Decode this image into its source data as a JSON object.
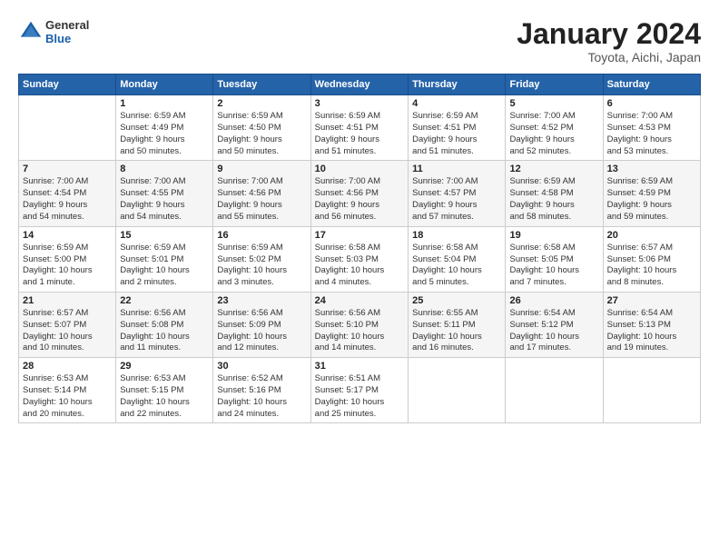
{
  "logo": {
    "general": "General",
    "blue": "Blue"
  },
  "title": "January 2024",
  "subtitle": "Toyota, Aichi, Japan",
  "days_header": [
    "Sunday",
    "Monday",
    "Tuesday",
    "Wednesday",
    "Thursday",
    "Friday",
    "Saturday"
  ],
  "weeks": [
    [
      {
        "num": "",
        "info": ""
      },
      {
        "num": "1",
        "info": "Sunrise: 6:59 AM\nSunset: 4:49 PM\nDaylight: 9 hours\nand 50 minutes."
      },
      {
        "num": "2",
        "info": "Sunrise: 6:59 AM\nSunset: 4:50 PM\nDaylight: 9 hours\nand 50 minutes."
      },
      {
        "num": "3",
        "info": "Sunrise: 6:59 AM\nSunset: 4:51 PM\nDaylight: 9 hours\nand 51 minutes."
      },
      {
        "num": "4",
        "info": "Sunrise: 6:59 AM\nSunset: 4:51 PM\nDaylight: 9 hours\nand 51 minutes."
      },
      {
        "num": "5",
        "info": "Sunrise: 7:00 AM\nSunset: 4:52 PM\nDaylight: 9 hours\nand 52 minutes."
      },
      {
        "num": "6",
        "info": "Sunrise: 7:00 AM\nSunset: 4:53 PM\nDaylight: 9 hours\nand 53 minutes."
      }
    ],
    [
      {
        "num": "7",
        "info": "Sunrise: 7:00 AM\nSunset: 4:54 PM\nDaylight: 9 hours\nand 54 minutes."
      },
      {
        "num": "8",
        "info": "Sunrise: 7:00 AM\nSunset: 4:55 PM\nDaylight: 9 hours\nand 54 minutes."
      },
      {
        "num": "9",
        "info": "Sunrise: 7:00 AM\nSunset: 4:56 PM\nDaylight: 9 hours\nand 55 minutes."
      },
      {
        "num": "10",
        "info": "Sunrise: 7:00 AM\nSunset: 4:56 PM\nDaylight: 9 hours\nand 56 minutes."
      },
      {
        "num": "11",
        "info": "Sunrise: 7:00 AM\nSunset: 4:57 PM\nDaylight: 9 hours\nand 57 minutes."
      },
      {
        "num": "12",
        "info": "Sunrise: 6:59 AM\nSunset: 4:58 PM\nDaylight: 9 hours\nand 58 minutes."
      },
      {
        "num": "13",
        "info": "Sunrise: 6:59 AM\nSunset: 4:59 PM\nDaylight: 9 hours\nand 59 minutes."
      }
    ],
    [
      {
        "num": "14",
        "info": "Sunrise: 6:59 AM\nSunset: 5:00 PM\nDaylight: 10 hours\nand 1 minute."
      },
      {
        "num": "15",
        "info": "Sunrise: 6:59 AM\nSunset: 5:01 PM\nDaylight: 10 hours\nand 2 minutes."
      },
      {
        "num": "16",
        "info": "Sunrise: 6:59 AM\nSunset: 5:02 PM\nDaylight: 10 hours\nand 3 minutes."
      },
      {
        "num": "17",
        "info": "Sunrise: 6:58 AM\nSunset: 5:03 PM\nDaylight: 10 hours\nand 4 minutes."
      },
      {
        "num": "18",
        "info": "Sunrise: 6:58 AM\nSunset: 5:04 PM\nDaylight: 10 hours\nand 5 minutes."
      },
      {
        "num": "19",
        "info": "Sunrise: 6:58 AM\nSunset: 5:05 PM\nDaylight: 10 hours\nand 7 minutes."
      },
      {
        "num": "20",
        "info": "Sunrise: 6:57 AM\nSunset: 5:06 PM\nDaylight: 10 hours\nand 8 minutes."
      }
    ],
    [
      {
        "num": "21",
        "info": "Sunrise: 6:57 AM\nSunset: 5:07 PM\nDaylight: 10 hours\nand 10 minutes."
      },
      {
        "num": "22",
        "info": "Sunrise: 6:56 AM\nSunset: 5:08 PM\nDaylight: 10 hours\nand 11 minutes."
      },
      {
        "num": "23",
        "info": "Sunrise: 6:56 AM\nSunset: 5:09 PM\nDaylight: 10 hours\nand 12 minutes."
      },
      {
        "num": "24",
        "info": "Sunrise: 6:56 AM\nSunset: 5:10 PM\nDaylight: 10 hours\nand 14 minutes."
      },
      {
        "num": "25",
        "info": "Sunrise: 6:55 AM\nSunset: 5:11 PM\nDaylight: 10 hours\nand 16 minutes."
      },
      {
        "num": "26",
        "info": "Sunrise: 6:54 AM\nSunset: 5:12 PM\nDaylight: 10 hours\nand 17 minutes."
      },
      {
        "num": "27",
        "info": "Sunrise: 6:54 AM\nSunset: 5:13 PM\nDaylight: 10 hours\nand 19 minutes."
      }
    ],
    [
      {
        "num": "28",
        "info": "Sunrise: 6:53 AM\nSunset: 5:14 PM\nDaylight: 10 hours\nand 20 minutes."
      },
      {
        "num": "29",
        "info": "Sunrise: 6:53 AM\nSunset: 5:15 PM\nDaylight: 10 hours\nand 22 minutes."
      },
      {
        "num": "30",
        "info": "Sunrise: 6:52 AM\nSunset: 5:16 PM\nDaylight: 10 hours\nand 24 minutes."
      },
      {
        "num": "31",
        "info": "Sunrise: 6:51 AM\nSunset: 5:17 PM\nDaylight: 10 hours\nand 25 minutes."
      },
      {
        "num": "",
        "info": ""
      },
      {
        "num": "",
        "info": ""
      },
      {
        "num": "",
        "info": ""
      }
    ]
  ]
}
